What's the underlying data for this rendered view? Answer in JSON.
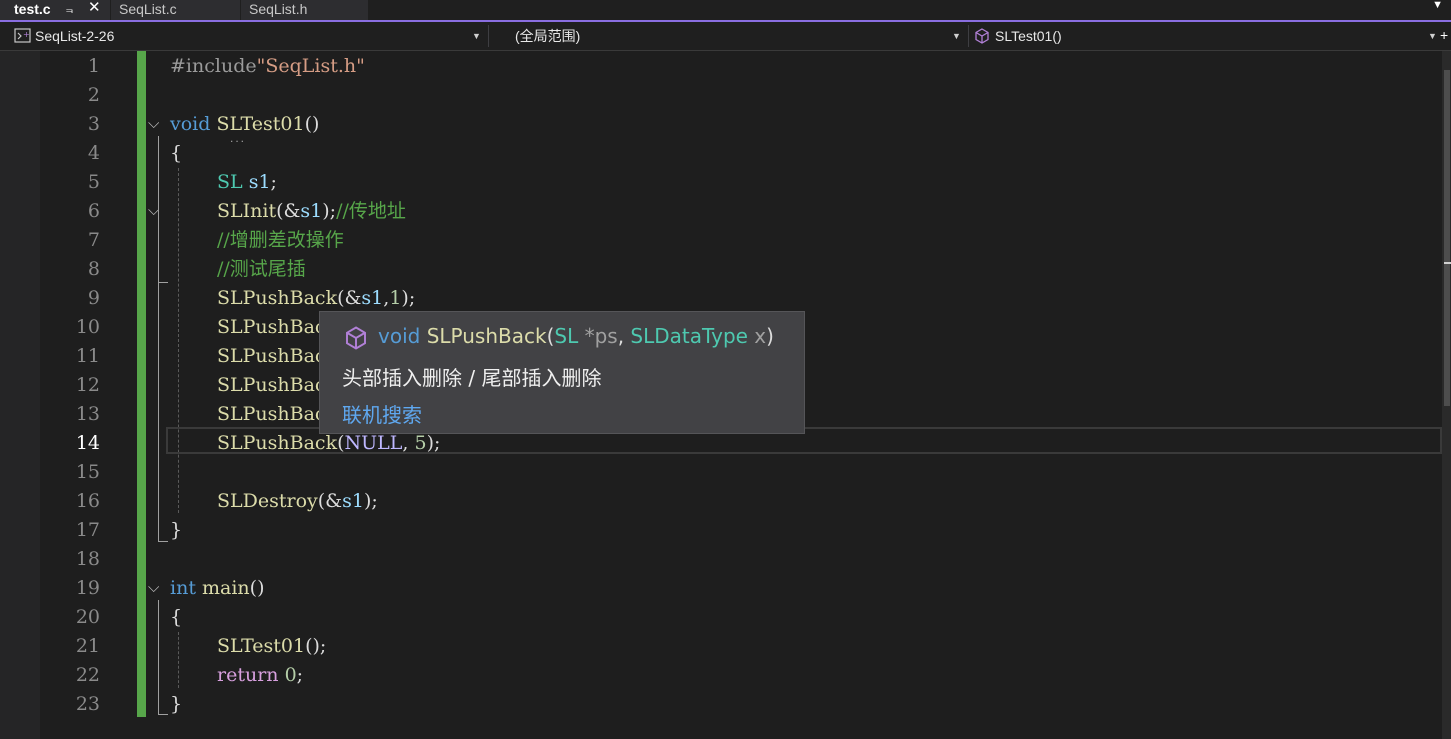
{
  "tabs": [
    {
      "label": "test.c",
      "active": true,
      "pin_icon": "pin-icon",
      "close_icon": "close-icon"
    },
    {
      "label": "SeqList.c",
      "active": false
    },
    {
      "label": "SeqList.h",
      "active": false
    }
  ],
  "navbar": {
    "project": "SeqList-2-26",
    "scope": "(全局范围)",
    "member": "SLTest01()"
  },
  "editor": {
    "current_line": 14,
    "line_numbers": [
      "1",
      "2",
      "3",
      "4",
      "5",
      "6",
      "7",
      "8",
      "9",
      "10",
      "11",
      "12",
      "13",
      "14",
      "15",
      "16",
      "17",
      "18",
      "19",
      "20",
      "21",
      "22",
      "23"
    ],
    "lines": {
      "l1": {
        "directive": "#include",
        "path": "\"SeqList.h\""
      },
      "l3": {
        "kw": "void",
        "name": "SLTest01",
        "rest": "()"
      },
      "l4": "{",
      "l5": {
        "type": "SL",
        "var": "s1",
        "rest": ";"
      },
      "l6": {
        "fn": "SLInit",
        "open": "(&",
        "var": "s1",
        "close": ");",
        "comment": "//传地址"
      },
      "l7": "//增删差改操作",
      "l8": "//测试尾插",
      "l9": {
        "fn": "SLPushBack",
        "open": "(&",
        "var": "s1",
        "sep": ",",
        "num": "1",
        "close": ");"
      },
      "l10": "SLPushBack",
      "l11": "SLPushBack",
      "l12": "SLPushBack",
      "l13": "SLPushBack",
      "l14": {
        "fn": "SLPushBack",
        "open": "(",
        "mac": "NULL",
        "sep": ", ",
        "num": "5",
        "close": ");"
      },
      "l16": {
        "fn": "SLDestroy",
        "open": "(&",
        "var": "s1",
        "close": ");"
      },
      "l17": "}",
      "l19": {
        "kw": "int",
        "name": "main",
        "rest": "()"
      },
      "l20": "{",
      "l21": {
        "fn": "SLTest01",
        "rest": "();"
      },
      "l22": {
        "kw": "return",
        "num": "0",
        "rest": ";"
      },
      "l23": "}"
    }
  },
  "quickinfo": {
    "icon": "method-cube-icon",
    "signature": {
      "ret": "void",
      "name": "SLPushBack",
      "open": "(",
      "p1_type": "SL",
      "p1_name": " *ps",
      "comma": ", ",
      "p2_type": "SLDataType",
      "p2_name": " x",
      "close": ")"
    },
    "description": "头部插入删除 / 尾部插入删除",
    "link": "联机搜索"
  },
  "colors": {
    "background": "#1e1e1e",
    "tab_accent": "#8a6ee0",
    "change_bar": "#57a64a",
    "keyword": "#569cd6",
    "type": "#4ec9b0",
    "function": "#dcdcaa",
    "variable": "#9cdcfe",
    "comment": "#57a64a",
    "string": "#d69d85"
  }
}
